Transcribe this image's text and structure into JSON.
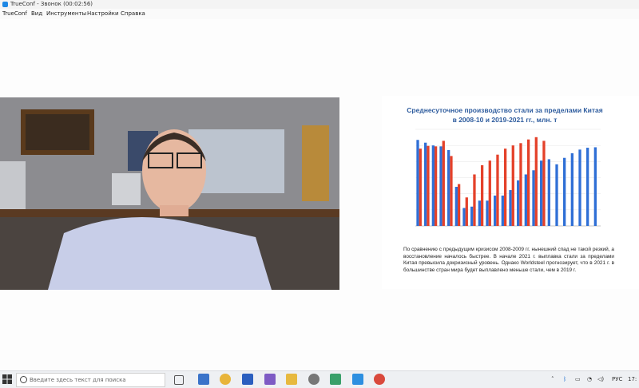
{
  "window": {
    "title": "TrueConf - Звонок (00:02:56)"
  },
  "menu": [
    {
      "label": "TrueConf"
    },
    {
      "label": "Вид"
    },
    {
      "label": "Инструменты"
    },
    {
      "label": "Настройки"
    },
    {
      "label": "Справка"
    }
  ],
  "slide": {
    "title_line1": "Среднесуточное производство стали за пределами Китая",
    "title_line2": "в 2008-10 и 2019-2021 гг., млн. т",
    "body": "По сравнению с предыдущим кризисом 2008-2009 гг. нынешний спад не такой резкий, а восстановление началось быстрее. В начале 2021 г. выплавка стали за пределами Китая превысила докризисный уровень. Однако Worldsteel прогнозирует, что в 2021 г. в большинстве стран мира будет выплавлено меньше стали, чем в 2019 г."
  },
  "chart_data": {
    "type": "bar",
    "series": [
      {
        "name": "",
        "color": "#2f6fd6",
        "values": [
          3.37,
          3.31,
          3.25,
          3.23,
          3.15,
          2.35,
          1.89,
          1.92,
          2.05,
          2.05,
          2.16,
          2.16,
          2.28,
          2.49,
          2.62,
          2.71,
          2.92,
          2.95,
          2.84,
          2.98,
          3.08,
          3.16,
          3.2,
          3.21
        ]
      },
      {
        "name": "",
        "color": "#e4412a",
        "values": [
          3.18,
          3.24,
          3.23,
          3.35,
          3.02,
          2.41,
          2.12,
          2.62,
          2.82,
          2.92,
          3.05,
          3.18,
          3.25,
          3.3,
          3.38,
          3.43,
          3.35,
          null,
          null,
          null,
          null,
          null,
          null,
          null
        ]
      }
    ],
    "ylim": [
      1.5,
      3.6
    ]
  },
  "taskbar": {
    "search_placeholder": "Введите здесь текст для поиска",
    "lang": "РУС",
    "time": "17:"
  }
}
